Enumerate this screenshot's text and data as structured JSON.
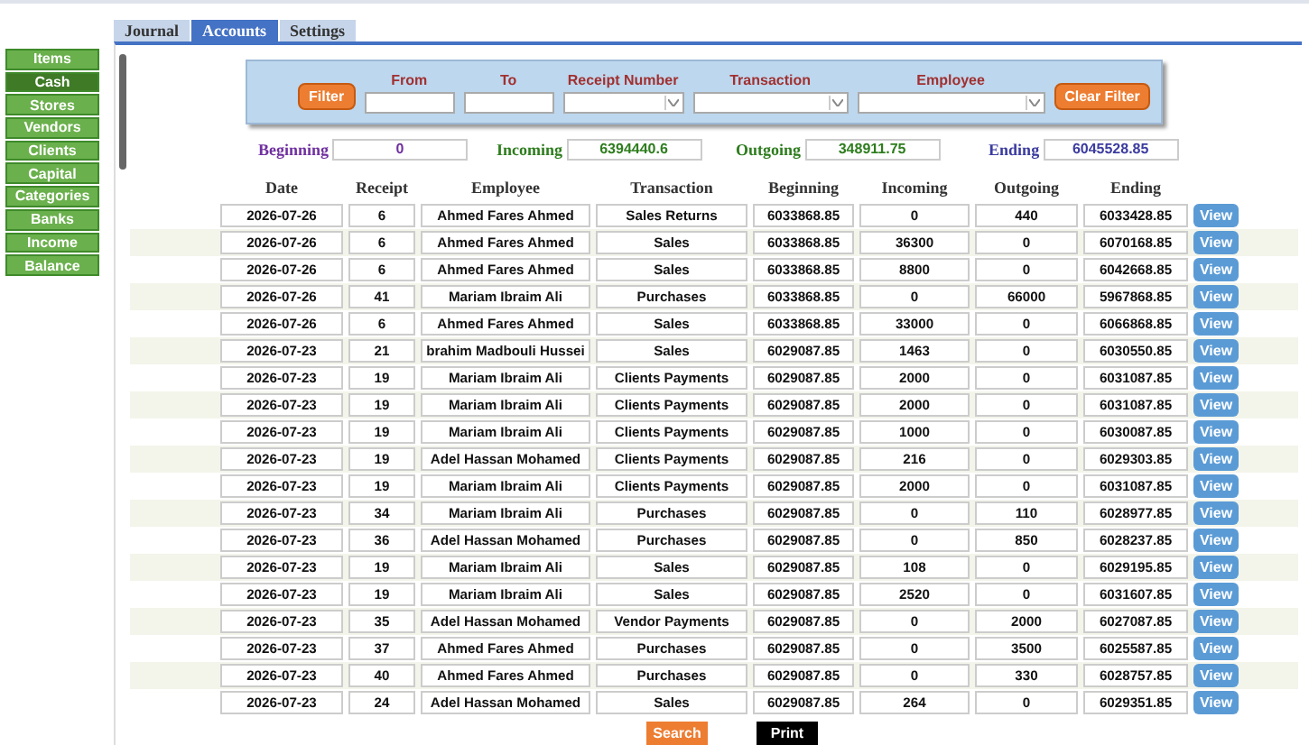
{
  "tabs": [
    {
      "label": "Journal",
      "selected": false
    },
    {
      "label": "Accounts",
      "selected": true
    },
    {
      "label": "Settings",
      "selected": false
    }
  ],
  "sidebar": {
    "items": [
      {
        "label": "Items",
        "selected": false
      },
      {
        "label": "Cash",
        "selected": true
      },
      {
        "label": "Stores",
        "selected": false
      },
      {
        "label": "Vendors",
        "selected": false
      },
      {
        "label": "Clients",
        "selected": false
      },
      {
        "label": "Capital",
        "selected": false
      },
      {
        "label": "Categories",
        "selected": false
      },
      {
        "label": "Banks",
        "selected": false
      },
      {
        "label": "Income",
        "selected": false
      },
      {
        "label": "Balance",
        "selected": false
      }
    ]
  },
  "filter": {
    "button": "Filter",
    "fields": [
      {
        "label": "From",
        "kind": "text"
      },
      {
        "label": "To",
        "kind": "text"
      },
      {
        "label": "Receipt Number",
        "kind": "select"
      },
      {
        "label": "Transaction",
        "kind": "select"
      },
      {
        "label": "Employee",
        "kind": "select"
      }
    ],
    "clear_button": "Clear Filter"
  },
  "summary": [
    {
      "label": "Beginning",
      "value": "0",
      "color": "#7030a0"
    },
    {
      "label": "Incoming",
      "value": "6394440.6",
      "color": "#2e7d1e"
    },
    {
      "label": "Outgoing",
      "value": "348911.75",
      "color": "#2e7d1e"
    },
    {
      "label": "Ending",
      "value": "6045528.85",
      "color": "#3b3ba0"
    }
  ],
  "table": {
    "columns": [
      "Date",
      "Receipt",
      "Employee",
      "Transaction",
      "Beginning",
      "Incoming",
      "Outgoing",
      "Ending"
    ],
    "rows": [
      {
        "cells": [
          "2026-07-26",
          "6",
          "Ahmed Fares Ahmed",
          "Sales Returns",
          "6033868.85",
          "0",
          "440",
          "6033428.85"
        ],
        "action": "View"
      },
      {
        "cells": [
          "2026-07-26",
          "6",
          "Ahmed Fares Ahmed",
          "Sales",
          "6033868.85",
          "36300",
          "0",
          "6070168.85"
        ],
        "action": "View"
      },
      {
        "cells": [
          "2026-07-26",
          "6",
          "Ahmed Fares Ahmed",
          "Sales",
          "6033868.85",
          "8800",
          "0",
          "6042668.85"
        ],
        "action": "View"
      },
      {
        "cells": [
          "2026-07-26",
          "41",
          "Mariam Ibraim Ali",
          "Purchases",
          "6033868.85",
          "0",
          "66000",
          "5967868.85"
        ],
        "action": "View"
      },
      {
        "cells": [
          "2026-07-26",
          "6",
          "Ahmed Fares Ahmed",
          "Sales",
          "6033868.85",
          "33000",
          "0",
          "6066868.85"
        ],
        "action": "View"
      },
      {
        "cells": [
          "2026-07-23",
          "21",
          "brahim Madbouli Hussei",
          "Sales",
          "6029087.85",
          "1463",
          "0",
          "6030550.85"
        ],
        "action": "View"
      },
      {
        "cells": [
          "2026-07-23",
          "19",
          "Mariam Ibraim Ali",
          "Clients Payments",
          "6029087.85",
          "2000",
          "0",
          "6031087.85"
        ],
        "action": "View"
      },
      {
        "cells": [
          "2026-07-23",
          "19",
          "Mariam Ibraim Ali",
          "Clients Payments",
          "6029087.85",
          "2000",
          "0",
          "6031087.85"
        ],
        "action": "View"
      },
      {
        "cells": [
          "2026-07-23",
          "19",
          "Mariam Ibraim Ali",
          "Clients Payments",
          "6029087.85",
          "1000",
          "0",
          "6030087.85"
        ],
        "action": "View"
      },
      {
        "cells": [
          "2026-07-23",
          "19",
          "Adel Hassan Mohamed",
          "Clients Payments",
          "6029087.85",
          "216",
          "0",
          "6029303.85"
        ],
        "action": "View"
      },
      {
        "cells": [
          "2026-07-23",
          "19",
          "Mariam Ibraim Ali",
          "Clients Payments",
          "6029087.85",
          "2000",
          "0",
          "6031087.85"
        ],
        "action": "View"
      },
      {
        "cells": [
          "2026-07-23",
          "34",
          "Mariam Ibraim Ali",
          "Purchases",
          "6029087.85",
          "0",
          "110",
          "6028977.85"
        ],
        "action": "View"
      },
      {
        "cells": [
          "2026-07-23",
          "36",
          "Adel Hassan Mohamed",
          "Purchases",
          "6029087.85",
          "0",
          "850",
          "6028237.85"
        ],
        "action": "View"
      },
      {
        "cells": [
          "2026-07-23",
          "19",
          "Mariam Ibraim Ali",
          "Sales",
          "6029087.85",
          "108",
          "0",
          "6029195.85"
        ],
        "action": "View"
      },
      {
        "cells": [
          "2026-07-23",
          "19",
          "Mariam Ibraim Ali",
          "Sales",
          "6029087.85",
          "2520",
          "0",
          "6031607.85"
        ],
        "action": "View"
      },
      {
        "cells": [
          "2026-07-23",
          "35",
          "Adel Hassan Mohamed",
          "Vendor Payments",
          "6029087.85",
          "0",
          "2000",
          "6027087.85"
        ],
        "action": "View"
      },
      {
        "cells": [
          "2026-07-23",
          "37",
          "Ahmed Fares Ahmed",
          "Purchases",
          "6029087.85",
          "0",
          "3500",
          "6025587.85"
        ],
        "action": "View"
      },
      {
        "cells": [
          "2026-07-23",
          "40",
          "Ahmed Fares Ahmed",
          "Purchases",
          "6029087.85",
          "0",
          "330",
          "6028757.85"
        ],
        "action": "View"
      },
      {
        "cells": [
          "2026-07-23",
          "24",
          "Adel Hassan Mohamed",
          "Sales",
          "6029087.85",
          "264",
          "0",
          "6029351.85"
        ],
        "action": "View"
      }
    ]
  },
  "footer": {
    "buttons": [
      {
        "label": "Search",
        "kind": "search"
      },
      {
        "label": "Print",
        "kind": "print"
      }
    ]
  }
}
